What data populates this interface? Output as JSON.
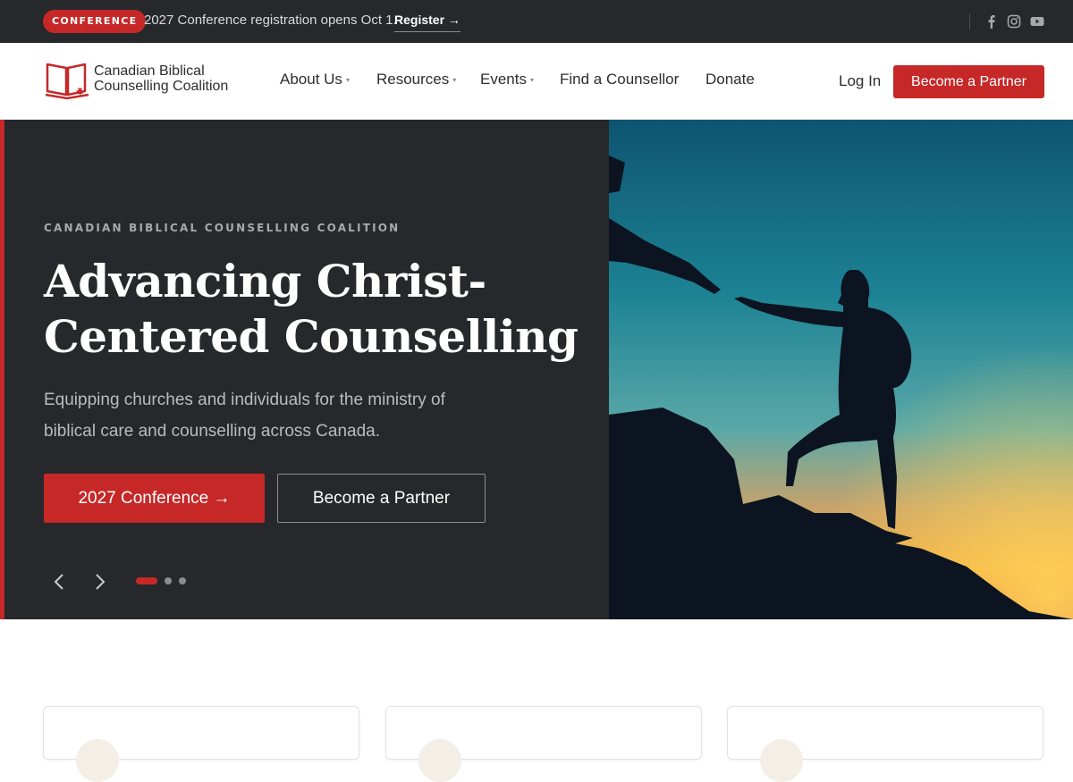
{
  "topbar": {
    "badge": "CONFERENCE",
    "message": "2027 Conference registration opens Oct 1.",
    "link": "Register →",
    "social_icons": [
      "facebook-icon",
      "instagram-icon",
      "youtube-icon"
    ]
  },
  "header": {
    "logo_line1": "Canadian Biblical",
    "logo_line2": "Counselling Coalition",
    "nav": [
      {
        "label": "About Us",
        "has_dropdown": true
      },
      {
        "label": "Resources",
        "has_dropdown": true
      },
      {
        "label": "Events",
        "has_dropdown": true
      },
      {
        "label": "Find a Counsellor",
        "has_dropdown": false
      },
      {
        "label": "Donate",
        "has_dropdown": false
      }
    ],
    "caret": "▾",
    "login": "Log In",
    "cta": "Become a Partner"
  },
  "hero": {
    "eyebrow": "CANADIAN BIBLICAL COUNSELLING COALITION",
    "title": "Advancing Christ-Centered Counselling",
    "subtitle": "Equipping churches and individuals for the ministry of biblical care and counselling across Canada.",
    "primary_button": "2027 Conference →",
    "secondary_button": "Become a Partner",
    "slides": 3,
    "active_slide": 1
  },
  "colors": {
    "accent": "#c62828",
    "dark": "#26282c",
    "text_muted": "#b9bbbf"
  }
}
